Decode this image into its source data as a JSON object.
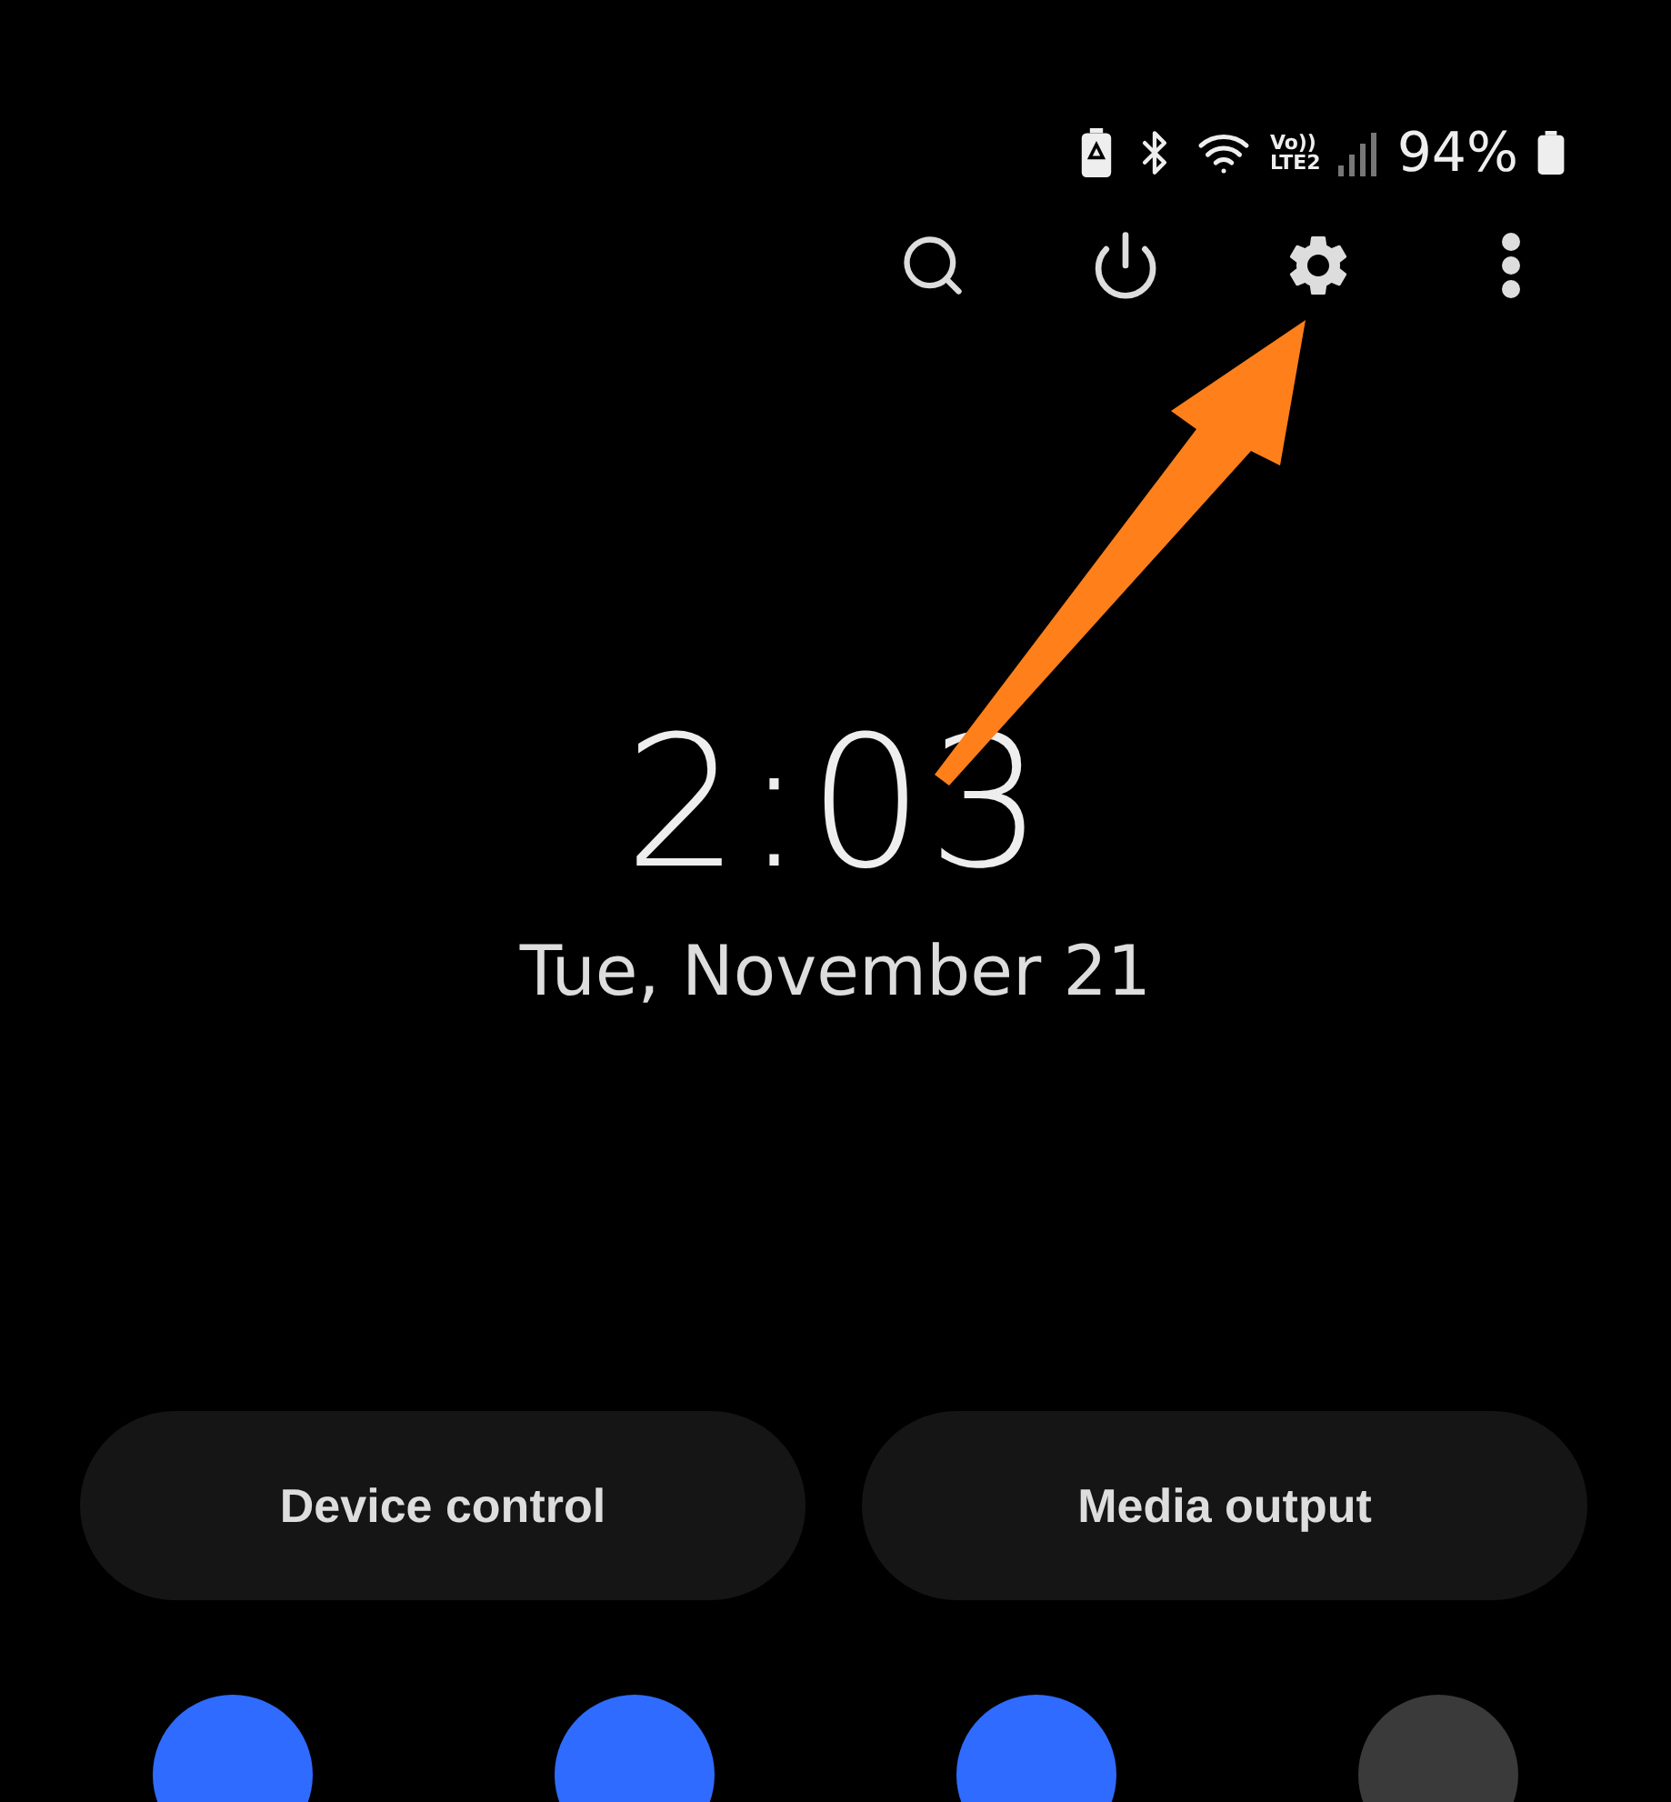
{
  "status_bar": {
    "volte": "Vo))",
    "network": "LTE2",
    "battery": "94%"
  },
  "clock": {
    "time": "2:03",
    "date": "Tue, November 21"
  },
  "buttons": [
    "Device control",
    "Media output"
  ],
  "tiles": [
    {
      "on": true
    },
    {
      "on": true
    },
    {
      "on": true
    },
    {
      "on": false
    }
  ]
}
